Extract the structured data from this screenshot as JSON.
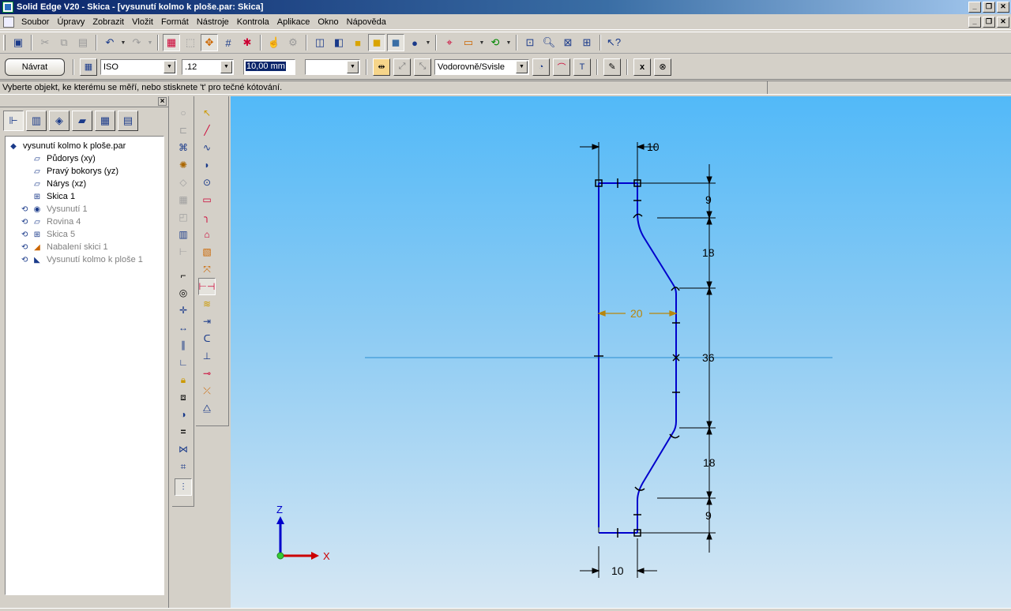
{
  "window": {
    "title": "Solid Edge V20 - Skica - [vysunutí kolmo k ploše.par: Skica]"
  },
  "menu": [
    "Soubor",
    "Úpravy",
    "Zobrazit",
    "Vložit",
    "Formát",
    "Nástroje",
    "Kontrola",
    "Aplikace",
    "Okno",
    "Nápověda"
  ],
  "ribbon": {
    "back_button": "Návrat",
    "standard_select": "ISO",
    "precision_select": ".12",
    "value_input": "10,00 mm",
    "orientation_select": "Vodorovně/Svisle",
    "x_label": "x"
  },
  "status": {
    "prompt": "Vyberte objekt, ke kterému se měří, nebo stisknete 't' pro tečné kótování."
  },
  "tree": {
    "root": "vysunutí kolmo k ploše.par",
    "items": [
      {
        "label": "Půdorys (xy)",
        "dim": false
      },
      {
        "label": "Pravý bokorys (yz)",
        "dim": false
      },
      {
        "label": "Nárys (xz)",
        "dim": false
      },
      {
        "label": "Skica 1",
        "dim": false
      },
      {
        "label": "Vysunutí 1",
        "dim": true
      },
      {
        "label": "Rovina 4",
        "dim": true
      },
      {
        "label": "Skica 5",
        "dim": true
      },
      {
        "label": "Nabalení skici 1",
        "dim": true
      },
      {
        "label": "Vysunutí kolmo k ploše 1",
        "dim": true
      }
    ]
  },
  "sketch": {
    "dimensions": {
      "top_width": "10",
      "bottom_width": "10",
      "v1": "9",
      "v2": "18",
      "v3": "36",
      "v4": "18",
      "v5": "9",
      "active_width": "20"
    },
    "axis": {
      "z": "Z",
      "x": "X"
    }
  },
  "colors": {
    "profile": "#0000cc",
    "active_dimension": "#b8860b",
    "canvas_top": "#52b9f8",
    "canvas_bottom": "#d6e7f3"
  }
}
